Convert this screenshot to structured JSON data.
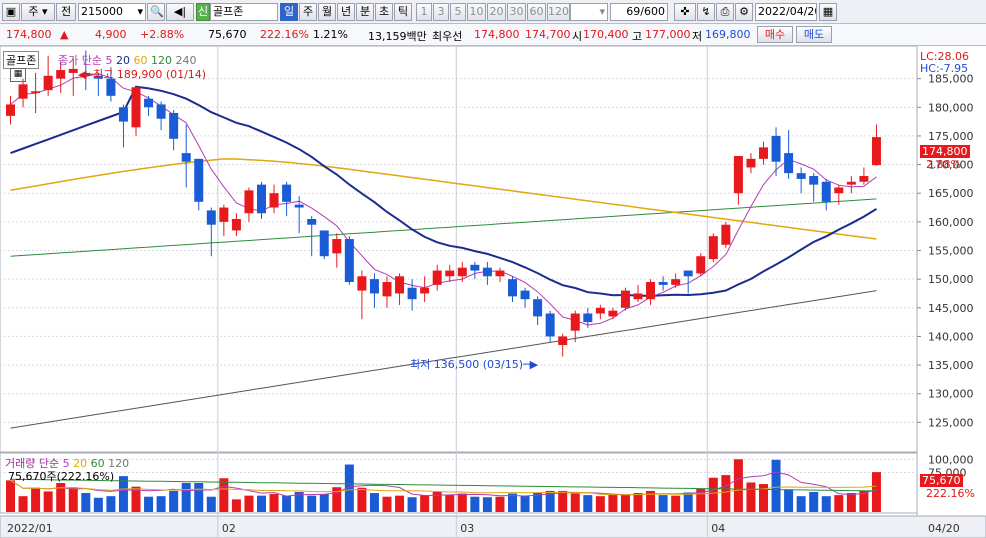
{
  "toolbar": {
    "market": "주",
    "jeon": "전",
    "code": "215000",
    "nav_prev": "◀",
    "nav_icon": "|",
    "sector_badge": "신",
    "name": "골프존",
    "periods": [
      "일",
      "주",
      "월",
      "년",
      "분",
      "초",
      "틱"
    ],
    "period_active": "일",
    "minutes": [
      "1",
      "3",
      "5",
      "10",
      "20",
      "30",
      "60",
      "120"
    ],
    "count": "69/600",
    "date": "2022/04/20"
  },
  "info": {
    "price": "174,800",
    "arrow": "▲",
    "change": "4,900",
    "change_pct": "+2.88%",
    "volume": "75,670",
    "volume_ratio": "222.16%",
    "turnover": "1.21%",
    "amount": "13,159백만",
    "priority_label": "최우선",
    "ask": "174,800",
    "bid": "174,700",
    "open_label": "시",
    "open": "170,400",
    "high_label": "고",
    "high": "177,000",
    "low_label": "저",
    "low": "169,800",
    "buy": "매수",
    "sell": "매도"
  },
  "price_legend": {
    "name": "골프존",
    "title": "종가 단순",
    "ma": [
      "5",
      "20",
      "60",
      "120",
      "240"
    ]
  },
  "volume_legend": {
    "title": "거래량 단순",
    "ma": [
      "5",
      "20",
      "60",
      "120"
    ],
    "value": "75,670주(222.16%)"
  },
  "annotations": {
    "high": "최고 189,900 (01/14)",
    "low": "최저 136,500 (03/15)",
    "lc": "LC:28.06",
    "hc": "HC:-7.95"
  },
  "current_tag": {
    "price": "174,800",
    "pct": "2.88%"
  },
  "volume_tag": {
    "value": "75,670",
    "pct": "222.16%"
  },
  "colors": {
    "up": "#e8191d",
    "down": "#1a5bd6",
    "ma5": "#b43cb4",
    "ma20": "#1a2d8f",
    "ma60": "#e0a80f",
    "ma120": "#2e8b3a",
    "ma240": "#555555"
  },
  "chart_data": {
    "type": "candlestick",
    "y_axis": {
      "min": 120000,
      "max": 190000,
      "ticks": [
        "185,000",
        "180,000",
        "175,000",
        "170,000",
        "165,000",
        "160,000",
        "155,000",
        "150,000",
        "145,000",
        "140,000",
        "135,000",
        "130,000",
        "125,000"
      ]
    },
    "volume_axis": {
      "ticks": [
        "100,000",
        "75,000"
      ]
    },
    "x_labels": [
      "2022/01",
      "02",
      "03",
      "04"
    ],
    "end_label": "04/20",
    "candles": [
      {
        "o": 178500,
        "c": 180500,
        "h": 182000,
        "l": 177000,
        "v": 60000
      },
      {
        "o": 181500,
        "c": 184000,
        "h": 185000,
        "l": 180000,
        "v": 30000
      },
      {
        "o": 182500,
        "c": 182800,
        "h": 186000,
        "l": 179000,
        "v": 46000
      },
      {
        "o": 183000,
        "c": 185500,
        "h": 189000,
        "l": 182000,
        "v": 39000
      },
      {
        "o": 185000,
        "c": 186500,
        "h": 188000,
        "l": 182500,
        "v": 55000
      },
      {
        "o": 186000,
        "c": 186700,
        "h": 188500,
        "l": 182000,
        "v": 47000
      },
      {
        "o": 186000,
        "c": 185500,
        "h": 189900,
        "l": 183000,
        "v": 36000
      },
      {
        "o": 185500,
        "c": 185000,
        "h": 186000,
        "l": 182000,
        "v": 27000
      },
      {
        "o": 185000,
        "c": 182000,
        "h": 187000,
        "l": 181000,
        "v": 30000
      },
      {
        "o": 180000,
        "c": 177500,
        "h": 180500,
        "l": 173000,
        "v": 68000
      },
      {
        "o": 176500,
        "c": 183500,
        "h": 183800,
        "l": 175000,
        "v": 48000
      },
      {
        "o": 181500,
        "c": 180000,
        "h": 182000,
        "l": 178500,
        "v": 29000
      },
      {
        "o": 180500,
        "c": 178000,
        "h": 181000,
        "l": 176000,
        "v": 30000
      },
      {
        "o": 179000,
        "c": 174500,
        "h": 179500,
        "l": 172500,
        "v": 40000
      },
      {
        "o": 172000,
        "c": 170500,
        "h": 177000,
        "l": 166000,
        "v": 55000
      },
      {
        "o": 171000,
        "c": 163500,
        "h": 171000,
        "l": 162000,
        "v": 55000
      },
      {
        "o": 162000,
        "c": 159500,
        "h": 162500,
        "l": 154000,
        "v": 29000
      },
      {
        "o": 160000,
        "c": 162500,
        "h": 163000,
        "l": 157500,
        "v": 64000
      },
      {
        "o": 158500,
        "c": 160500,
        "h": 161500,
        "l": 157500,
        "v": 24000
      },
      {
        "o": 161500,
        "c": 165500,
        "h": 166000,
        "l": 160000,
        "v": 31000
      },
      {
        "o": 166500,
        "c": 161500,
        "h": 167000,
        "l": 160500,
        "v": 31000
      },
      {
        "o": 162500,
        "c": 165000,
        "h": 166500,
        "l": 161500,
        "v": 34000
      },
      {
        "o": 166500,
        "c": 163500,
        "h": 167000,
        "l": 161000,
        "v": 31000
      },
      {
        "o": 163000,
        "c": 162500,
        "h": 164500,
        "l": 158000,
        "v": 38000
      },
      {
        "o": 160500,
        "c": 159500,
        "h": 161000,
        "l": 154000,
        "v": 31000
      },
      {
        "o": 158500,
        "c": 154000,
        "h": 158500,
        "l": 153500,
        "v": 34000
      },
      {
        "o": 154500,
        "c": 157000,
        "h": 158000,
        "l": 152000,
        "v": 47000
      },
      {
        "o": 157000,
        "c": 149500,
        "h": 157500,
        "l": 149000,
        "v": 90000
      },
      {
        "o": 148000,
        "c": 150500,
        "h": 151500,
        "l": 143000,
        "v": 46000
      },
      {
        "o": 150000,
        "c": 147500,
        "h": 151000,
        "l": 145000,
        "v": 36000
      },
      {
        "o": 147000,
        "c": 149500,
        "h": 150500,
        "l": 145000,
        "v": 29000
      },
      {
        "o": 147500,
        "c": 150500,
        "h": 151000,
        "l": 145500,
        "v": 31000
      },
      {
        "o": 148500,
        "c": 146500,
        "h": 150000,
        "l": 144500,
        "v": 28000
      },
      {
        "o": 147500,
        "c": 148500,
        "h": 150500,
        "l": 146000,
        "v": 32000
      },
      {
        "o": 149000,
        "c": 151500,
        "h": 152500,
        "l": 148000,
        "v": 38000
      },
      {
        "o": 150500,
        "c": 151500,
        "h": 152500,
        "l": 149500,
        "v": 33000
      },
      {
        "o": 150500,
        "c": 152000,
        "h": 153000,
        "l": 149500,
        "v": 35000
      },
      {
        "o": 152500,
        "c": 151500,
        "h": 153000,
        "l": 150000,
        "v": 29000
      },
      {
        "o": 152000,
        "c": 150500,
        "h": 153000,
        "l": 149000,
        "v": 28000
      },
      {
        "o": 150500,
        "c": 151500,
        "h": 152000,
        "l": 149500,
        "v": 29000
      },
      {
        "o": 150000,
        "c": 147000,
        "h": 150500,
        "l": 146000,
        "v": 35000
      },
      {
        "o": 148000,
        "c": 146500,
        "h": 148500,
        "l": 145000,
        "v": 31000
      },
      {
        "o": 146500,
        "c": 143500,
        "h": 147000,
        "l": 142000,
        "v": 37000
      },
      {
        "o": 144000,
        "c": 140000,
        "h": 144500,
        "l": 139000,
        "v": 40000
      },
      {
        "o": 138500,
        "c": 140000,
        "h": 140500,
        "l": 136500,
        "v": 40000
      },
      {
        "o": 141000,
        "c": 144000,
        "h": 144500,
        "l": 139000,
        "v": 35000
      },
      {
        "o": 144000,
        "c": 142500,
        "h": 145000,
        "l": 141500,
        "v": 32000
      },
      {
        "o": 144000,
        "c": 145000,
        "h": 145500,
        "l": 143000,
        "v": 30000
      },
      {
        "o": 143500,
        "c": 144500,
        "h": 145000,
        "l": 143000,
        "v": 33000
      },
      {
        "o": 145000,
        "c": 148000,
        "h": 148500,
        "l": 144500,
        "v": 33000
      },
      {
        "o": 146500,
        "c": 147500,
        "h": 149000,
        "l": 146000,
        "v": 36000
      },
      {
        "o": 146500,
        "c": 149500,
        "h": 150000,
        "l": 145500,
        "v": 40000
      },
      {
        "o": 149500,
        "c": 149000,
        "h": 150500,
        "l": 148000,
        "v": 32000
      },
      {
        "o": 149000,
        "c": 150000,
        "h": 151000,
        "l": 148500,
        "v": 31000
      },
      {
        "o": 151500,
        "c": 150500,
        "h": 151500,
        "l": 147500,
        "v": 37000
      },
      {
        "o": 151000,
        "c": 154000,
        "h": 154500,
        "l": 150500,
        "v": 44000
      },
      {
        "o": 153500,
        "c": 157500,
        "h": 158000,
        "l": 153000,
        "v": 65000
      },
      {
        "o": 156000,
        "c": 159500,
        "h": 160000,
        "l": 155500,
        "v": 70000
      },
      {
        "o": 165000,
        "c": 171500,
        "h": 171500,
        "l": 163000,
        "v": 100000
      },
      {
        "o": 169500,
        "c": 171000,
        "h": 172000,
        "l": 168500,
        "v": 56000
      },
      {
        "o": 171000,
        "c": 173000,
        "h": 174000,
        "l": 170000,
        "v": 53000
      },
      {
        "o": 175000,
        "c": 170500,
        "h": 176500,
        "l": 168000,
        "v": 99000
      },
      {
        "o": 172000,
        "c": 168500,
        "h": 176000,
        "l": 167500,
        "v": 43000
      },
      {
        "o": 168500,
        "c": 167500,
        "h": 169500,
        "l": 165000,
        "v": 30000
      },
      {
        "o": 168000,
        "c": 166500,
        "h": 168500,
        "l": 163500,
        "v": 38000
      },
      {
        "o": 167000,
        "c": 163500,
        "h": 167500,
        "l": 162000,
        "v": 30000
      },
      {
        "o": 165000,
        "c": 166000,
        "h": 166500,
        "l": 163000,
        "v": 32000
      },
      {
        "o": 166500,
        "c": 167000,
        "h": 168000,
        "l": 165000,
        "v": 36000
      },
      {
        "o": 167000,
        "c": 168000,
        "h": 169500,
        "l": 166500,
        "v": 40000
      },
      {
        "o": 169900,
        "c": 174800,
        "h": 177000,
        "l": 169800,
        "v": 75670
      }
    ]
  }
}
